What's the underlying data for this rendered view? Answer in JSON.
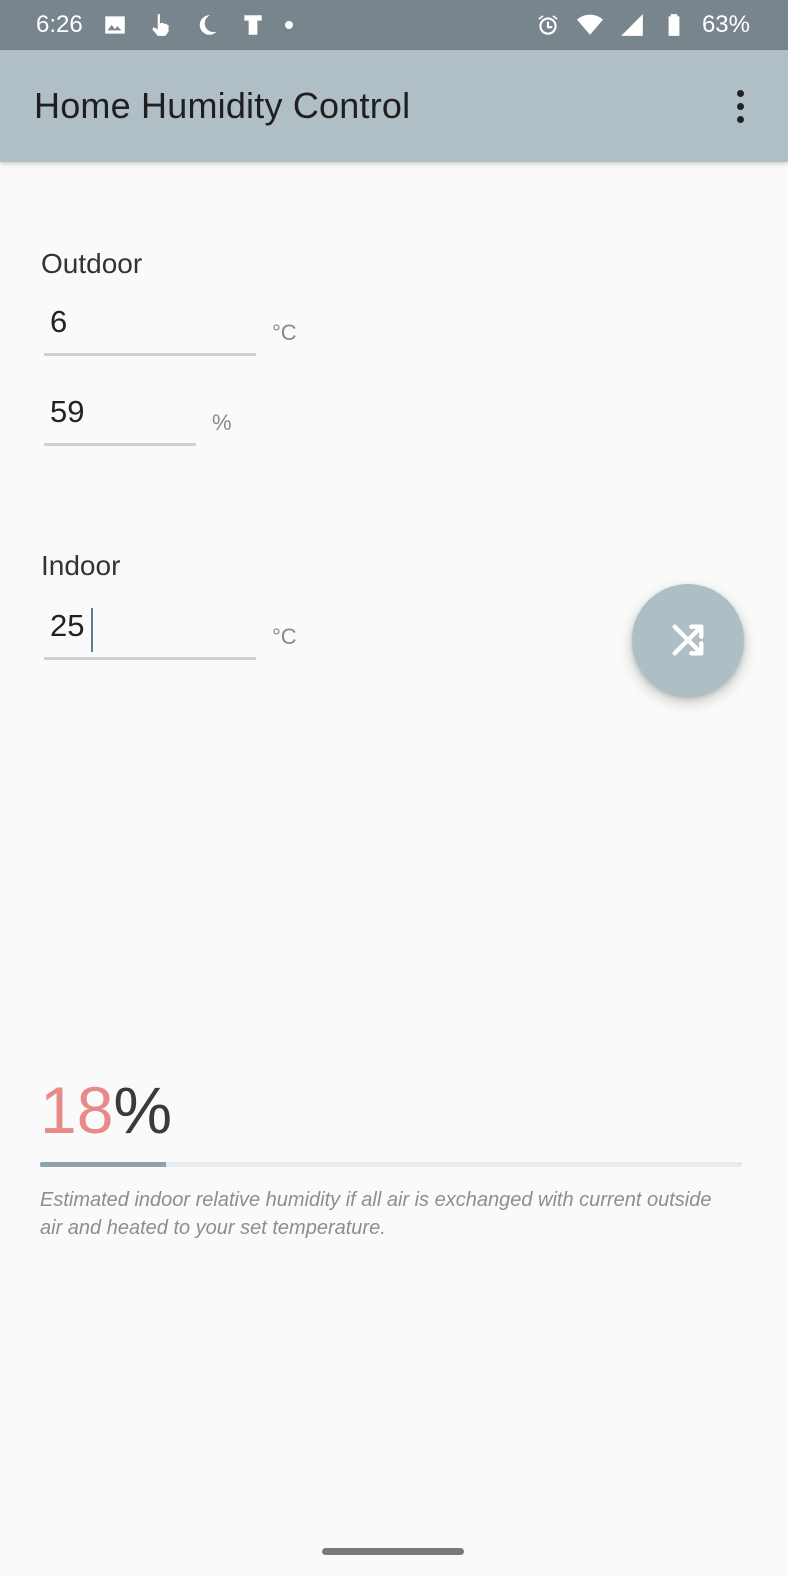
{
  "status_bar": {
    "time": "6:26",
    "battery": "63%"
  },
  "app_bar": {
    "title": "Home Humidity Control"
  },
  "outdoor": {
    "label": "Outdoor",
    "temperature_value": "6",
    "temperature_unit": "°C",
    "humidity_value": "59",
    "humidity_unit": "%"
  },
  "indoor": {
    "label": "Indoor",
    "temperature_value": "25",
    "temperature_unit": "°C"
  },
  "result": {
    "value": "18",
    "sign": "%",
    "progress_fraction": 0.18,
    "description": "Estimated indoor relative humidity if all air is exchanged with current outside air and heated to your set temperature."
  },
  "colors": {
    "app_bar": "#b0bec5",
    "status_bar": "#78858c",
    "accent_result": "#e88a87",
    "fab": "#aebec6"
  }
}
